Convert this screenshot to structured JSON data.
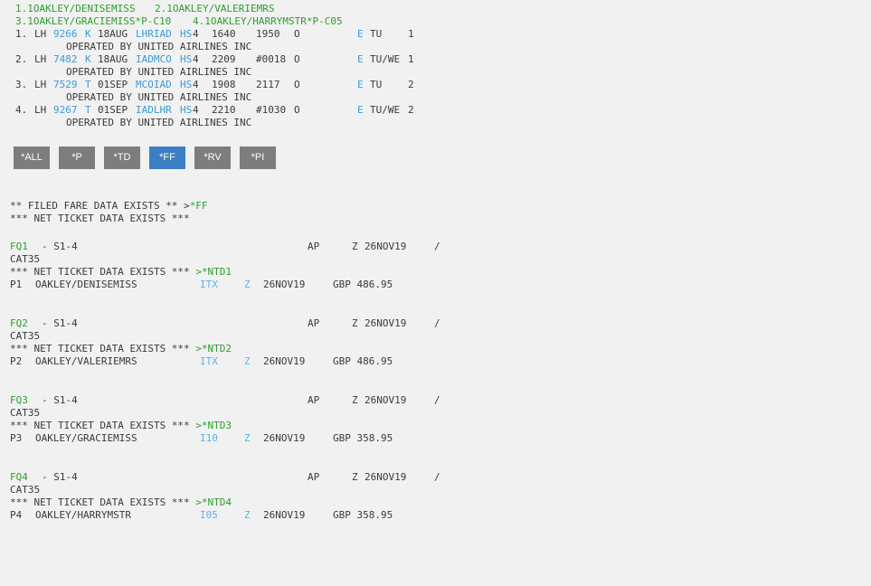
{
  "names": {
    "line1": [
      {
        "n": "1.1OAKLEY/DENISEMISS"
      },
      {
        "n": "2.1OAKLEY/VALERIEMRS"
      }
    ],
    "line2": [
      {
        "n": "3.1OAKLEY/GRACIEMISS*P-C10"
      },
      {
        "n": "4.1OAKLEY/HARRYMSTR*P-C05"
      }
    ]
  },
  "segments": [
    {
      "num": "1.",
      "air": "LH",
      "flt": "9266",
      "cls": "K",
      "date": "18AUG",
      "route": "LHRIAD",
      "hs": "HS",
      "hsn": "4",
      "dep": "1640",
      "arr": "1950",
      "stop": "O",
      "e": "E",
      "days": "TU",
      "n": "1",
      "op": "OPERATED BY UNITED AIRLINES INC"
    },
    {
      "num": "2.",
      "air": "LH",
      "flt": "7482",
      "cls": "K",
      "date": "18AUG",
      "route": "IADMCO",
      "hs": "HS",
      "hsn": "4",
      "dep": "2209",
      "arr": "#0018",
      "stop": "O",
      "e": "E",
      "days": "TU/WE",
      "n": "1",
      "op": "OPERATED BY UNITED AIRLINES INC"
    },
    {
      "num": "3.",
      "air": "LH",
      "flt": "7529",
      "cls": "T",
      "date": "01SEP",
      "route": "MCOIAD",
      "hs": "HS",
      "hsn": "4",
      "dep": "1908",
      "arr": "2117",
      "stop": "O",
      "e": "E",
      "days": "TU",
      "n": "2",
      "op": "OPERATED BY UNITED AIRLINES INC"
    },
    {
      "num": "4.",
      "air": "LH",
      "flt": "9267",
      "cls": "T",
      "date": "01SEP",
      "route": "IADLHR",
      "hs": "HS",
      "hsn": "4",
      "dep": "2210",
      "arr": "#1030",
      "stop": "O",
      "e": "E",
      "days": "TU/WE",
      "n": "2",
      "op": "OPERATED BY UNITED AIRLINES INC"
    }
  ],
  "buttons": [
    {
      "label": "*ALL",
      "active": false
    },
    {
      "label": "*P",
      "active": false
    },
    {
      "label": "*TD",
      "active": false
    },
    {
      "label": "*FF",
      "active": true
    },
    {
      "label": "*RV",
      "active": false
    },
    {
      "label": "*PI",
      "active": false
    }
  ],
  "notice": {
    "filed_text": "** FILED FARE DATA EXISTS ** >",
    "filed_link": "*FF",
    "net_text": "*** NET TICKET DATA EXISTS ***"
  },
  "fares": [
    {
      "fq": "FQ1",
      "seg": "- S1-4",
      "ap": "AP",
      "z": "Z",
      "date": "26NOV19",
      "slash": "/",
      "cat": "CAT35",
      "net_text": "*** NET TICKET DATA EXISTS *** ",
      "net_link": ">*NTD1",
      "pax": "P1",
      "name": "OAKLEY/DENISEMISS",
      "code": "ITX",
      "zc": "Z",
      "fdate": "26NOV19",
      "amount": "GBP 486.95"
    },
    {
      "fq": "FQ2",
      "seg": "- S1-4",
      "ap": "AP",
      "z": "Z",
      "date": "26NOV19",
      "slash": "/",
      "cat": "CAT35",
      "net_text": "*** NET TICKET DATA EXISTS *** ",
      "net_link": ">*NTD2",
      "pax": "P2",
      "name": "OAKLEY/VALERIEMRS",
      "code": "ITX",
      "zc": "Z",
      "fdate": "26NOV19",
      "amount": "GBP 486.95"
    },
    {
      "fq": "FQ3",
      "seg": "- S1-4",
      "ap": "AP",
      "z": "Z",
      "date": "26NOV19",
      "slash": "/",
      "cat": "CAT35",
      "net_text": "*** NET TICKET DATA EXISTS *** ",
      "net_link": ">*NTD3",
      "pax": "P3",
      "name": "OAKLEY/GRACIEMISS",
      "code": "I10",
      "zc": "Z",
      "fdate": "26NOV19",
      "amount": "GBP 358.95"
    },
    {
      "fq": "FQ4",
      "seg": "- S1-4",
      "ap": "AP",
      "z": "Z",
      "date": "26NOV19",
      "slash": "/",
      "cat": "CAT35",
      "net_text": "*** NET TICKET DATA EXISTS *** ",
      "net_link": ">*NTD4",
      "pax": "P4",
      "name": "OAKLEY/HARRYMSTR",
      "code": "I05",
      "zc": "Z",
      "fdate": "26NOV19",
      "amount": "GBP 358.95"
    }
  ]
}
